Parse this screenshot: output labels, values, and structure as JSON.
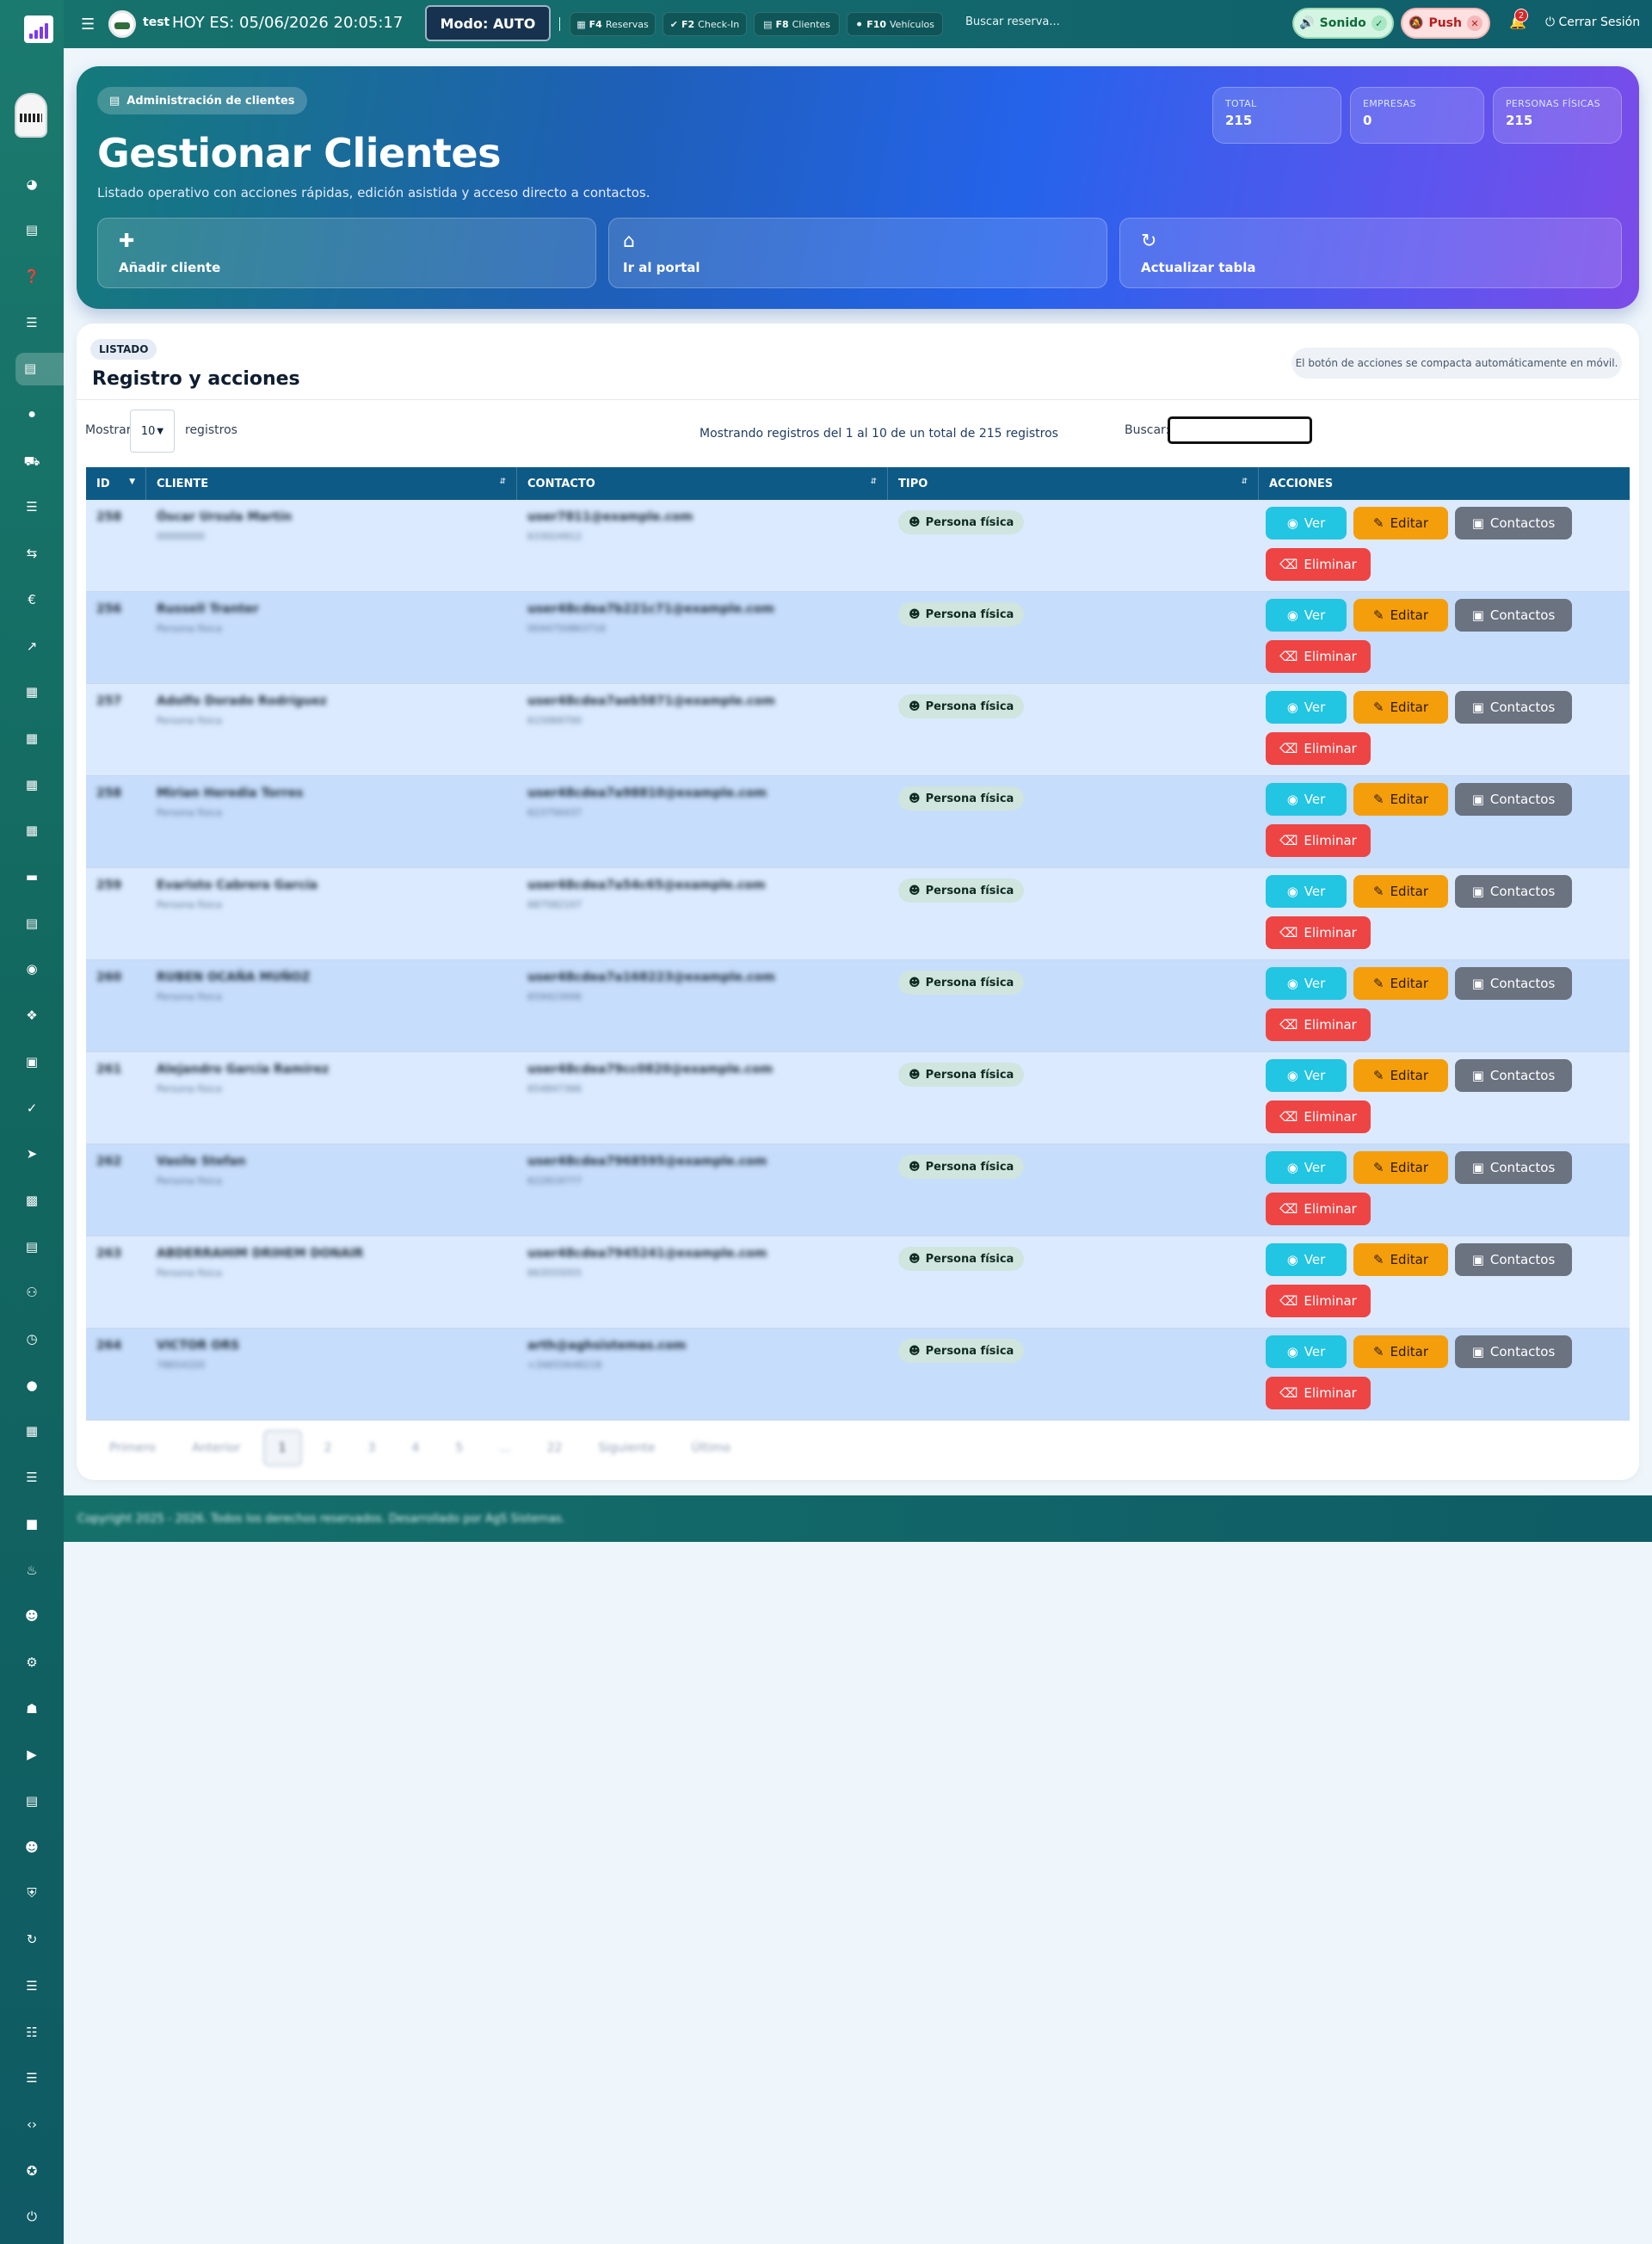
{
  "topbar": {
    "user": "test",
    "date_label": "HOY ES: 05/06/2026 20:05:17",
    "mode_label": "Modo: AUTO",
    "shortcuts": [
      {
        "key": "F4",
        "label": "Reservas"
      },
      {
        "key": "F2",
        "label": "Check-In"
      },
      {
        "key": "F8",
        "label": "Clientes"
      },
      {
        "key": "F10",
        "label": "Vehículos"
      }
    ],
    "search_label": "Buscar reserva...",
    "sound_label": "Sonido",
    "push_label": "Push",
    "notifications_count": "2",
    "logout_label": "Cerrar Sesión"
  },
  "hero": {
    "chip": "Administración de clientes",
    "title": "Gestionar Clientes",
    "subtitle": "Listado operativo con acciones rápidas, edición asistida y acceso directo a contactos.",
    "stats": [
      {
        "label": "TOTAL",
        "value": "215"
      },
      {
        "label": "EMPRESAS",
        "value": "0"
      },
      {
        "label": "PERSONAS FÍSICAS",
        "value": "215"
      }
    ],
    "actions": [
      {
        "label": "Añadir cliente",
        "icon": "user-plus-icon"
      },
      {
        "label": "Ir al portal",
        "icon": "home-icon"
      },
      {
        "label": "Actualizar tabla",
        "icon": "refresh-icon"
      }
    ]
  },
  "panel": {
    "chip": "LISTADO",
    "title": "Registro y acciones",
    "note": "El botón de acciones se compacta automáticamente en móvil.",
    "show_label": "Mostrar",
    "show_value": "10",
    "records_label": "registros",
    "info": "Mostrando registros del 1 al 10 de un total de 215 registros",
    "search_label": "Buscar:"
  },
  "table": {
    "headers": [
      "ID",
      "CLIENTE",
      "CONTACTO",
      "TIPO",
      "ACCIONES"
    ],
    "rows": [
      {
        "id": "258",
        "name": "Óscar Ursula Martín",
        "sub": "00000000",
        "email": "user7811@example.com",
        "phone": "633024912",
        "tipo": "Persona física"
      },
      {
        "id": "256",
        "name": "Russell Tranter",
        "sub": "Persona física",
        "email": "user48cdea7b221c71@example.com",
        "phone": "0044750863716",
        "tipo": "Persona física"
      },
      {
        "id": "257",
        "name": "Adolfo Dorado Rodríguez",
        "sub": "Persona física",
        "email": "user48cdea7aeb5871@example.com",
        "phone": "615069700",
        "tipo": "Persona física"
      },
      {
        "id": "258",
        "name": "Mirian Heredia Torres",
        "sub": "Persona física",
        "email": "user48cdea7a98810@example.com",
        "phone": "623756437",
        "tipo": "Persona física"
      },
      {
        "id": "259",
        "name": "Evaristo Cabrera García",
        "sub": "Persona física",
        "email": "user48cdea7a54c65@example.com",
        "phone": "687582107",
        "tipo": "Persona física"
      },
      {
        "id": "260",
        "name": "RUBEN OCAÑA MUÑOZ",
        "sub": "Persona física",
        "email": "user48cdea7a168223@example.com",
        "phone": "659423006",
        "tipo": "Persona física"
      },
      {
        "id": "261",
        "name": "Alejandro García Ramírez",
        "sub": "Persona física",
        "email": "user48cdea79cc0820@example.com",
        "phone": "654847366",
        "tipo": "Persona física"
      },
      {
        "id": "262",
        "name": "Vasile Stefan",
        "sub": "Persona física",
        "email": "user48cdea7968595@example.com",
        "phone": "622819777",
        "tipo": "Persona física"
      },
      {
        "id": "263",
        "name": "ABDERRAHIM DRIHEM DONAIR",
        "sub": "Persona física",
        "email": "user48cdea7945241@example.com",
        "phone": "663555055",
        "tipo": "Persona física"
      },
      {
        "id": "264",
        "name": "VICTOR ORS",
        "sub": "78654320",
        "email": "arth@aghsistemas.com",
        "phone": "+34655648218",
        "tipo": "Persona física"
      }
    ],
    "actions": {
      "view": "Ver",
      "edit": "Editar",
      "contacts": "Contactos",
      "delete": "Eliminar"
    }
  },
  "pager": [
    "Primero",
    "Anterior",
    "1",
    "2",
    "3",
    "4",
    "5",
    "...",
    "22",
    "Siguiente",
    "Último"
  ],
  "footer": {
    "text": "Copyright 2025 - 2026. Todos los derechos reservados. Desarrollado por AgS Sistemas."
  }
}
